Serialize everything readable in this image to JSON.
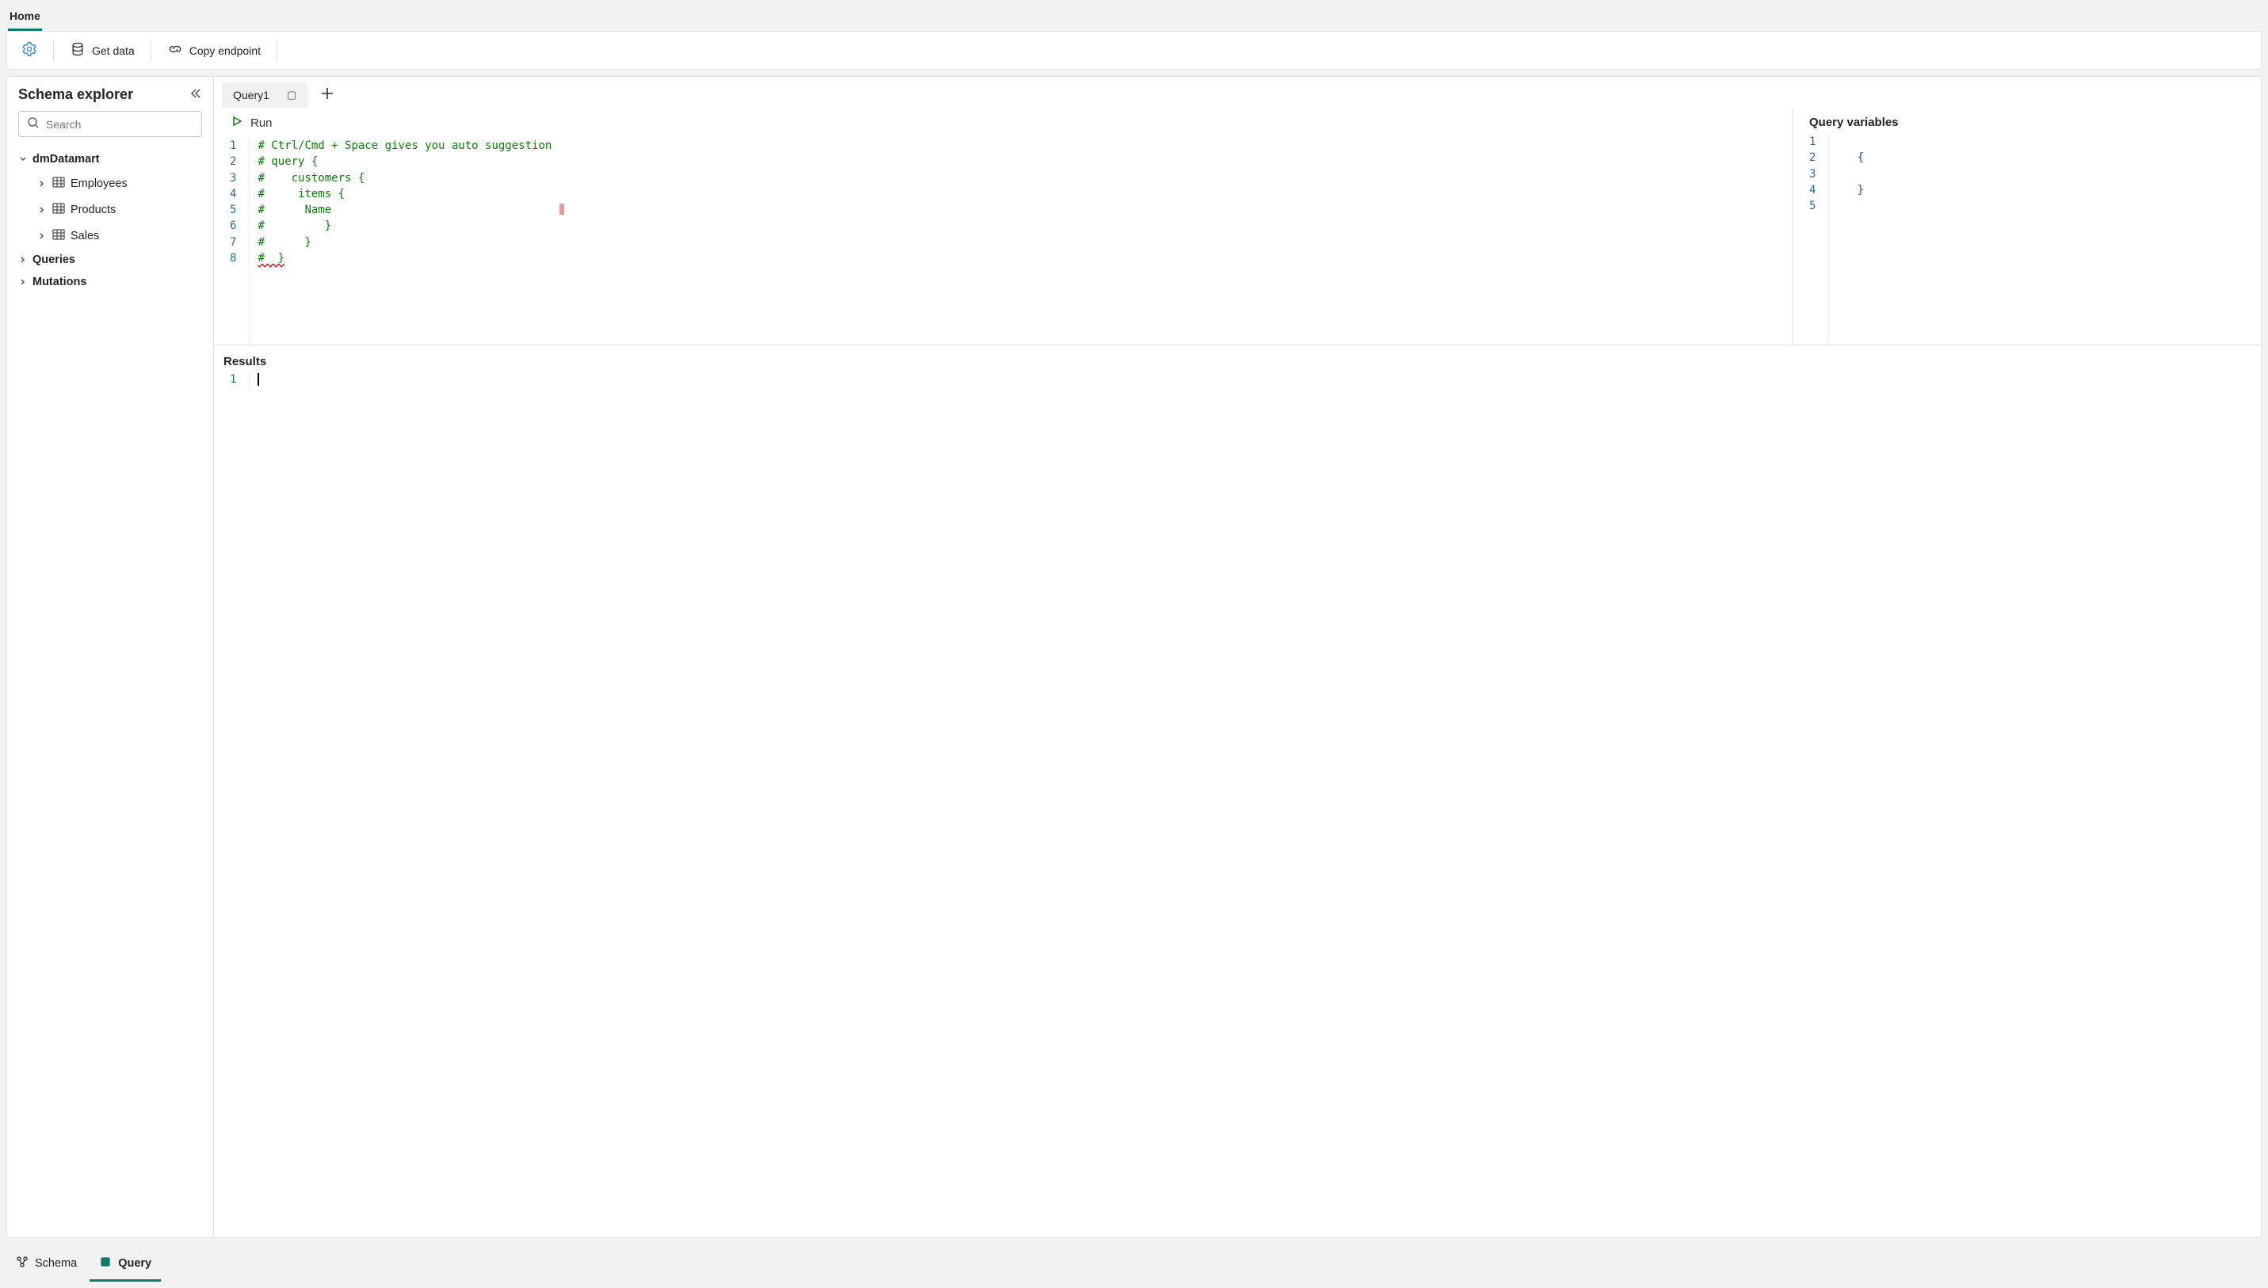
{
  "topTabs": {
    "home": "Home"
  },
  "toolbar": {
    "getData": "Get data",
    "copyEndpoint": "Copy endpoint"
  },
  "sidebar": {
    "title": "Schema explorer",
    "searchPlaceholder": "Search",
    "tree": {
      "root": "dmDatamart",
      "tables": [
        "Employees",
        "Products",
        "Sales"
      ],
      "queries": "Queries",
      "mutations": "Mutations"
    }
  },
  "tabs": {
    "query1": "Query1"
  },
  "run": "Run",
  "queryEditor": {
    "lineNumbers": [
      "1",
      "2",
      "3",
      "4",
      "5",
      "6",
      "7",
      "8"
    ],
    "lines": [
      "# Ctrl/Cmd + Space gives you auto suggestion",
      "# query {",
      "#    customers {",
      "#     items {",
      "#      Name",
      "#         }",
      "#      }",
      "#  }"
    ]
  },
  "variables": {
    "title": "Query variables",
    "lineNumbers": [
      "1",
      "2",
      "3",
      "4",
      "5"
    ],
    "lines": [
      "",
      "   {",
      "",
      "   }",
      ""
    ]
  },
  "results": {
    "title": "Results",
    "lineNumbers": [
      "1"
    ]
  },
  "statusBar": {
    "schema": "Schema",
    "query": "Query"
  }
}
